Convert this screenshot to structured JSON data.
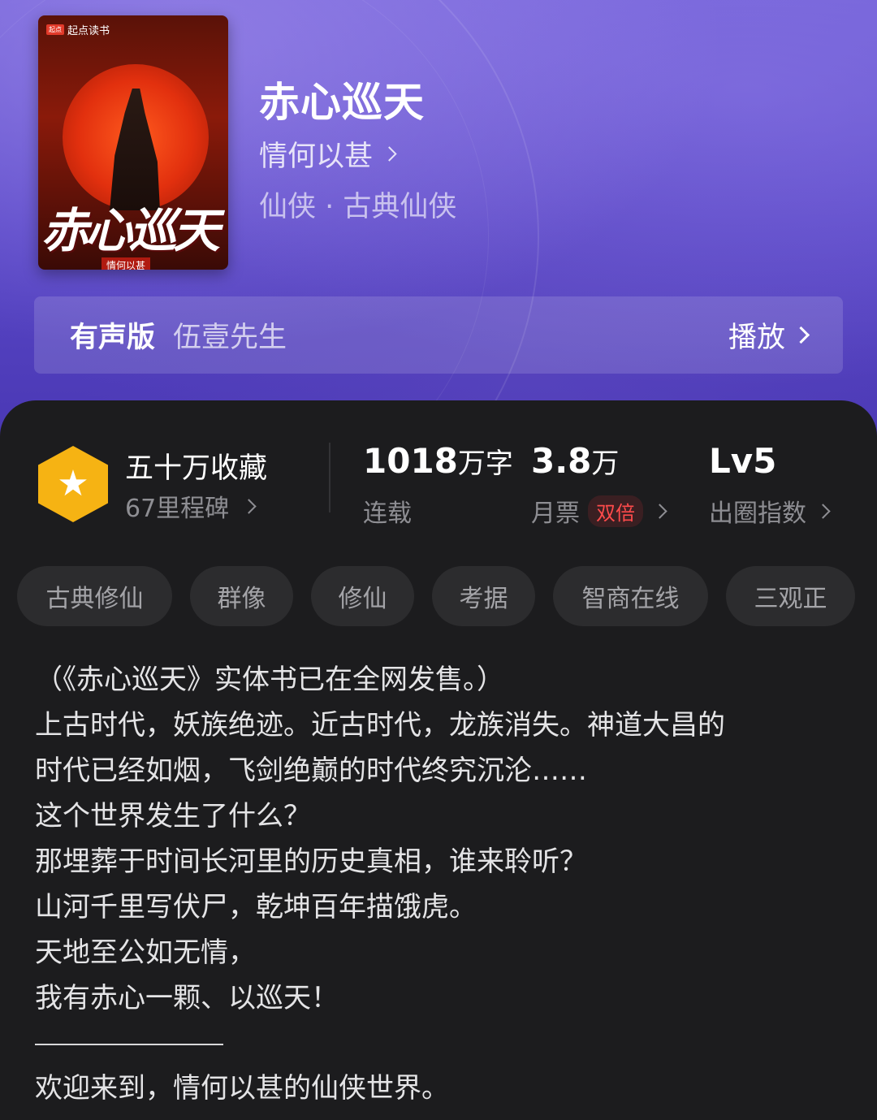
{
  "book": {
    "title": "赤心巡天",
    "author": "情何以甚",
    "genre": "仙侠 · 古典仙侠",
    "cover": {
      "brand": "起点读书",
      "brand_mark": "起点",
      "title": "赤心巡天",
      "author": "情何以甚"
    }
  },
  "audio": {
    "label": "有声版",
    "narrator": "伍壹先生",
    "play": "播放"
  },
  "stats": {
    "collect_main": "五十万收藏",
    "collect_sub": "67里程碑",
    "words_num": "1018",
    "words_unit": "万字",
    "status": "连载",
    "tickets_num": "3.8",
    "tickets_unit": "万",
    "tickets_label": "月票",
    "double_badge": "双倍",
    "level": "Lv5",
    "level_label": "出圈指数"
  },
  "tags": [
    "古典修仙",
    "群像",
    "修仙",
    "考据",
    "智商在线",
    "三观正"
  ],
  "description": {
    "lines": [
      "（《赤心巡天》实体书已在全网发售。）",
      "上古时代，妖族绝迹。近古时代，龙族消失。神道大昌的",
      "时代已经如烟，飞剑绝巅的时代终究沉沦……",
      "这个世界发生了什么？",
      "那埋葬于时间长河里的历史真相，谁来聆听？",
      "山河千里写伏尸，乾坤百年描饿虎。",
      "天地至公如无情，",
      "我有赤心一颗、以巡天！"
    ],
    "after_rule": "欢迎来到，情何以甚的仙侠世界。"
  },
  "colors": {
    "accent_badge": "#f6b313",
    "double_red": "#ff4b4b",
    "panel_bg": "#1c1c1e",
    "hero_purple": "#5a48c8"
  }
}
